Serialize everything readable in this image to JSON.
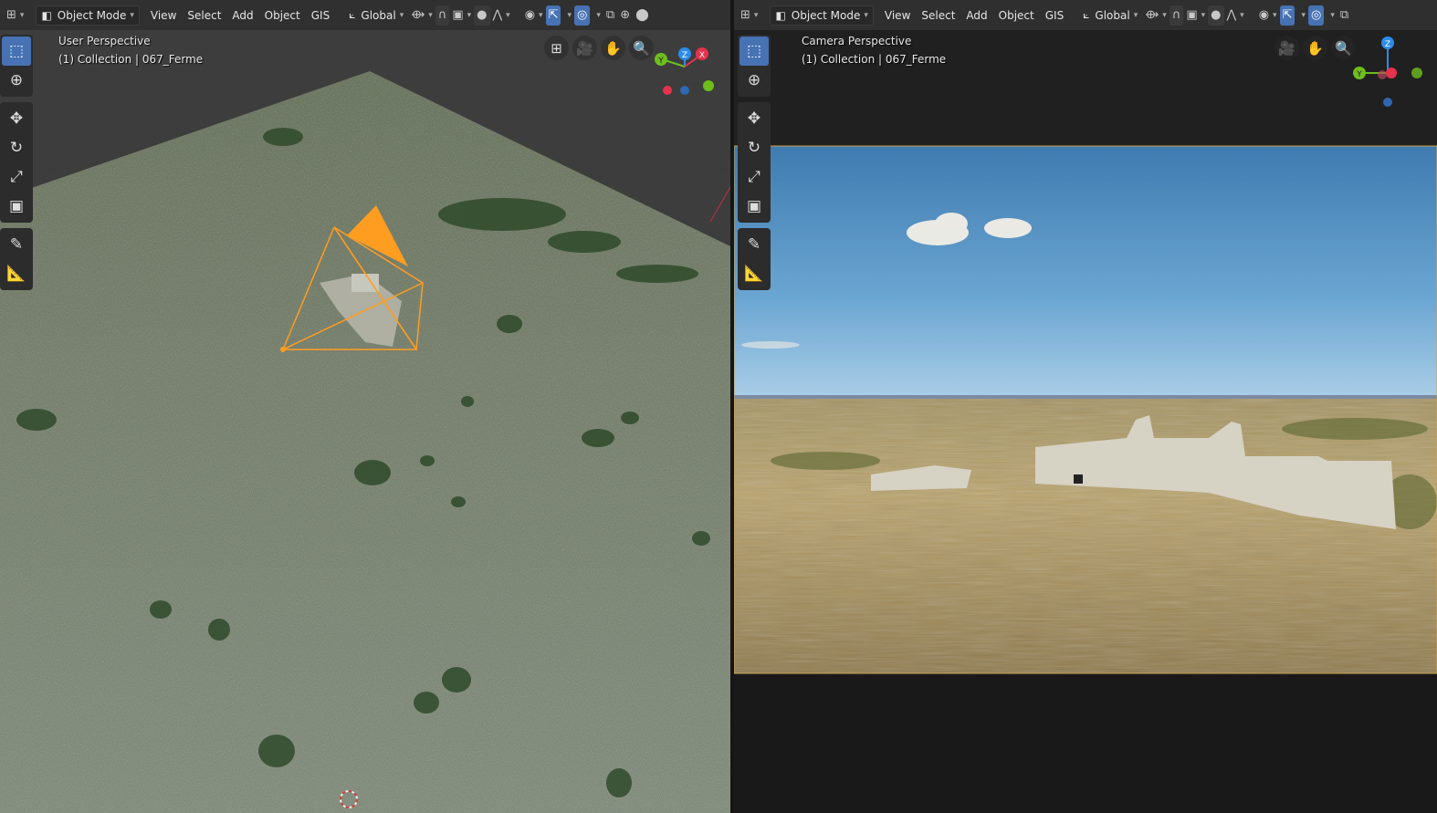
{
  "left": {
    "header": {
      "editor_icon": "viewport-icon",
      "mode": "Object Mode",
      "menus": [
        "View",
        "Select",
        "Add",
        "Object",
        "GIS"
      ],
      "orientation": "Global"
    },
    "overlay": {
      "view_name": "User Perspective",
      "collection": "(1) Collection | 067_Ferme"
    },
    "gizmo": {
      "z": "Z",
      "y": "Y",
      "x": "X"
    }
  },
  "right": {
    "header": {
      "editor_icon": "viewport-icon",
      "mode": "Object Mode",
      "menus": [
        "View",
        "Select",
        "Add",
        "Object",
        "GIS"
      ],
      "orientation": "Global"
    },
    "overlay": {
      "view_name": "Camera Perspective",
      "collection": "(1) Collection | 067_Ferme"
    },
    "gizmo": {
      "z": "Z",
      "y": "Y"
    }
  },
  "colors": {
    "accent": "#4772b3",
    "camera": "#ff9d21",
    "axis_x": "#e6324b",
    "axis_y": "#6ebe1e",
    "axis_z": "#2d8ceb"
  }
}
